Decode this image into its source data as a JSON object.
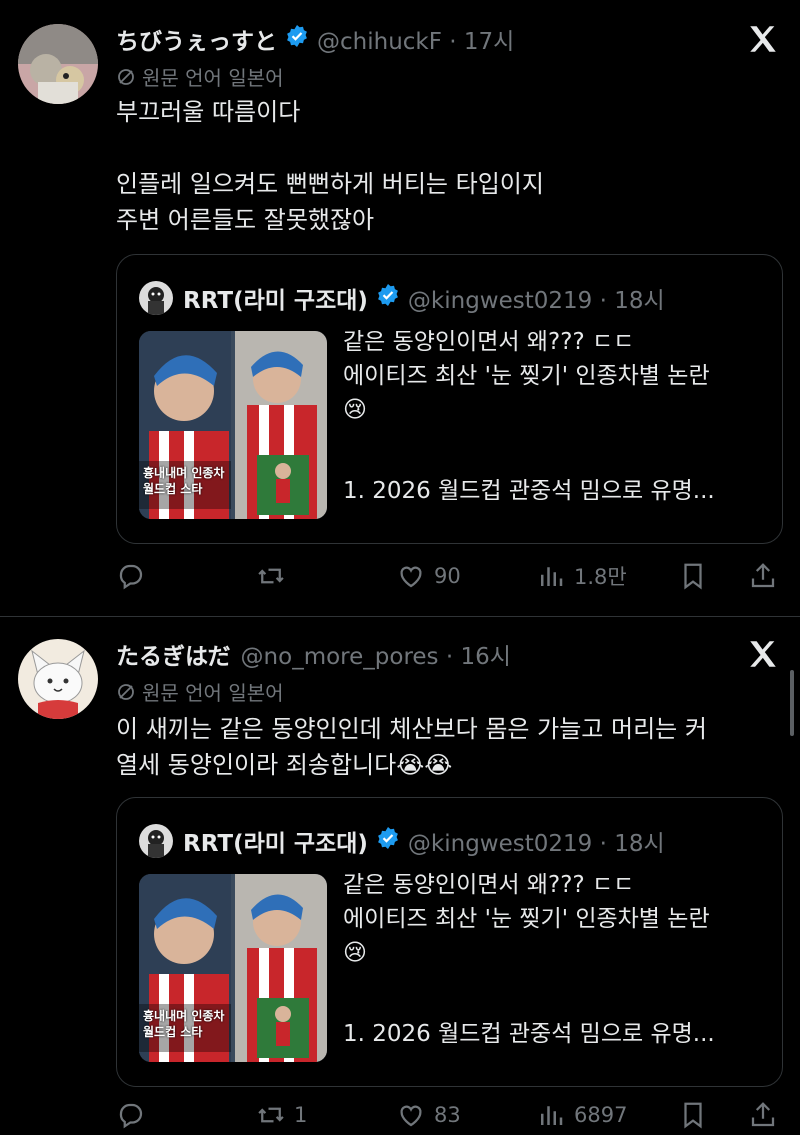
{
  "tweets": [
    {
      "display_name": "ちびうぇっすと",
      "handle": "@chihuckF · 17시",
      "translate_label": "원문 언어 일본어",
      "text": "부끄러울 따름이다\n\n인플레 일으켜도 뻔뻔하게 버티는 타입이지\n주변 어른들도 잘못했잖아",
      "quote": {
        "name": "RRT(라미 구조대)",
        "handle": "@kingwest0219 · 18시",
        "line1": "같은 동양인이면서 왜??? ㄷㄷ",
        "line2": "에이티즈 최산 '눈 찢기' 인종차별 논란",
        "emoji": "😢",
        "subline": "1. 2026 월드컵 관중석 밈으로 유명...",
        "thumb_caption_1": "흉내내며 인종차",
        "thumb_caption_2": "월드컵 스타"
      },
      "actions": {
        "replies": "",
        "reposts": "",
        "likes": "90",
        "views": "1.8만"
      }
    },
    {
      "display_name": "たるぎはだ",
      "handle": "@no_more_pores · 16시",
      "translate_label": "원문 언어 일본어",
      "text": "이 새끼는 같은 동양인인데 체산보다 몸은 가늘고 머리는 커\n열세 동양인이라 죄송합니다😭😭",
      "quote": {
        "name": "RRT(라미 구조대)",
        "handle": "@kingwest0219 · 18시",
        "line1": "같은 동양인이면서 왜??? ㄷㄷ",
        "line2": "에이티즈 최산 '눈 찢기' 인종차별 논란",
        "emoji": "😢",
        "subline": "1. 2026 월드컵 관중석 밈으로 유명...",
        "thumb_caption_1": "흉내내며 인종차",
        "thumb_caption_2": "월드컵 스타"
      },
      "actions": {
        "replies": "",
        "reposts": "1",
        "likes": "83",
        "views": "6897"
      }
    }
  ],
  "colors": {
    "background": "#000000",
    "text": "#e7e9ea",
    "muted": "#71767b",
    "verified": "#1d9bf0",
    "border": "#2f3336"
  },
  "icons": [
    "x-logo-icon",
    "verified-badge-icon",
    "translate-icon",
    "reply-icon",
    "repost-icon",
    "like-icon",
    "views-icon",
    "bookmark-icon",
    "share-icon"
  ]
}
